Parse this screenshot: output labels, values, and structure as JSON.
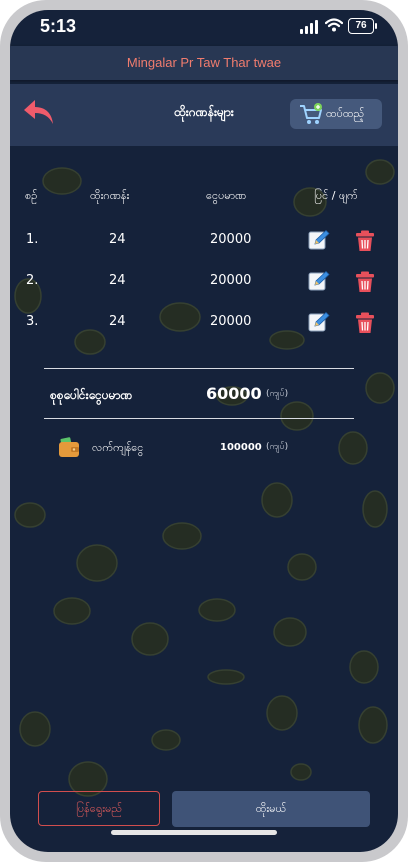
{
  "status_bar": {
    "time": "5:13",
    "battery": "76"
  },
  "banner": {
    "text": "Mingalar Pr Taw Thar twae"
  },
  "header": {
    "title": "ထိုးဂဏန်းများ",
    "add_label": "ထပ်ထည့်"
  },
  "table": {
    "headers": [
      "စဉ်",
      "ထိုးဂဏန်း",
      "ငွေပမာဏ",
      "ပြင် / ဖျက်"
    ],
    "rows": [
      {
        "no": "1.",
        "number": "24",
        "amount": "20000"
      },
      {
        "no": "2.",
        "number": "24",
        "amount": "20000"
      },
      {
        "no": "3.",
        "number": "24",
        "amount": "20000"
      }
    ]
  },
  "summary": {
    "total_label": "စုစုပေါင်းငွေပမာဏ",
    "total_value": "60000",
    "total_unit": "(ကျပ်)",
    "change_label": "လက်ကျန်ငွေ",
    "change_value": "100000",
    "change_unit": "(ကျပ်)"
  },
  "footer": {
    "cancel_label": "ပြန်ရွေးမည်",
    "order_label": "ထိုးမယ်"
  },
  "colors": {
    "background": "#15223a",
    "header": "#2a3a59",
    "banner_text": "#f07c6e",
    "primary_button": "#3f5377",
    "cancel_border": "#d14e4e",
    "delete_icon": "#e8505b",
    "back_icon": "#ef5b6b"
  },
  "icons": {
    "back": "back-arrow-icon",
    "cart": "shopping-cart-icon",
    "edit": "edit-icon",
    "delete": "trash-icon",
    "wallet": "wallet-icon"
  }
}
